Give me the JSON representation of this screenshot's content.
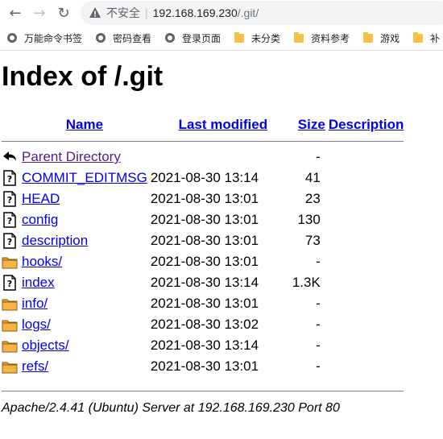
{
  "browser": {
    "security_label": "不安全",
    "url_host": "192.168.169.230",
    "url_path": "/.git/",
    "bookmarks": [
      {
        "label": "万能命令书签",
        "icon": "globe-icon"
      },
      {
        "label": "密码查看",
        "icon": "globe-icon"
      },
      {
        "label": "登录页面",
        "icon": "globe-icon"
      },
      {
        "label": "未分类",
        "icon": "folder-icon"
      },
      {
        "label": "资料参考",
        "icon": "folder-icon"
      },
      {
        "label": "游戏",
        "icon": "folder-icon"
      },
      {
        "label": "补",
        "icon": "folder-icon"
      }
    ]
  },
  "page": {
    "title": "Index of /.git",
    "columns": {
      "name": "Name",
      "last_modified": "Last modified",
      "size": "Size",
      "description": "Description"
    },
    "parent": {
      "name": "Parent Directory",
      "size": "-"
    },
    "rows": [
      {
        "name": "COMMIT_EDITMSG",
        "date": "2021-08-30 13:14",
        "size": "41",
        "icon": "file-unknown-icon"
      },
      {
        "name": "HEAD",
        "date": "2021-08-30 13:01",
        "size": "23",
        "icon": "file-unknown-icon"
      },
      {
        "name": "config",
        "date": "2021-08-30 13:01",
        "size": "130",
        "icon": "file-unknown-icon"
      },
      {
        "name": "description",
        "date": "2021-08-30 13:01",
        "size": "73",
        "icon": "file-unknown-icon"
      },
      {
        "name": "hooks/",
        "date": "2021-08-30 13:01",
        "size": "-",
        "icon": "folder-icon"
      },
      {
        "name": "index",
        "date": "2021-08-30 13:14",
        "size": "1.3K",
        "icon": "file-unknown-icon"
      },
      {
        "name": "info/",
        "date": "2021-08-30 13:01",
        "size": "-",
        "icon": "folder-icon"
      },
      {
        "name": "logs/",
        "date": "2021-08-30 13:02",
        "size": "-",
        "icon": "folder-icon"
      },
      {
        "name": "objects/",
        "date": "2021-08-30 13:14",
        "size": "-",
        "icon": "folder-icon"
      },
      {
        "name": "refs/",
        "date": "2021-08-30 13:01",
        "size": "-",
        "icon": "folder-icon"
      }
    ],
    "footer": "Apache/2.4.41 (Ubuntu) Server at 192.168.169.230 Port 80"
  },
  "colors": {
    "link": "#0000ee",
    "visited_link": "#551a8b",
    "folder": "#f0a030",
    "omnibox_bg": "#f1f3f4"
  }
}
